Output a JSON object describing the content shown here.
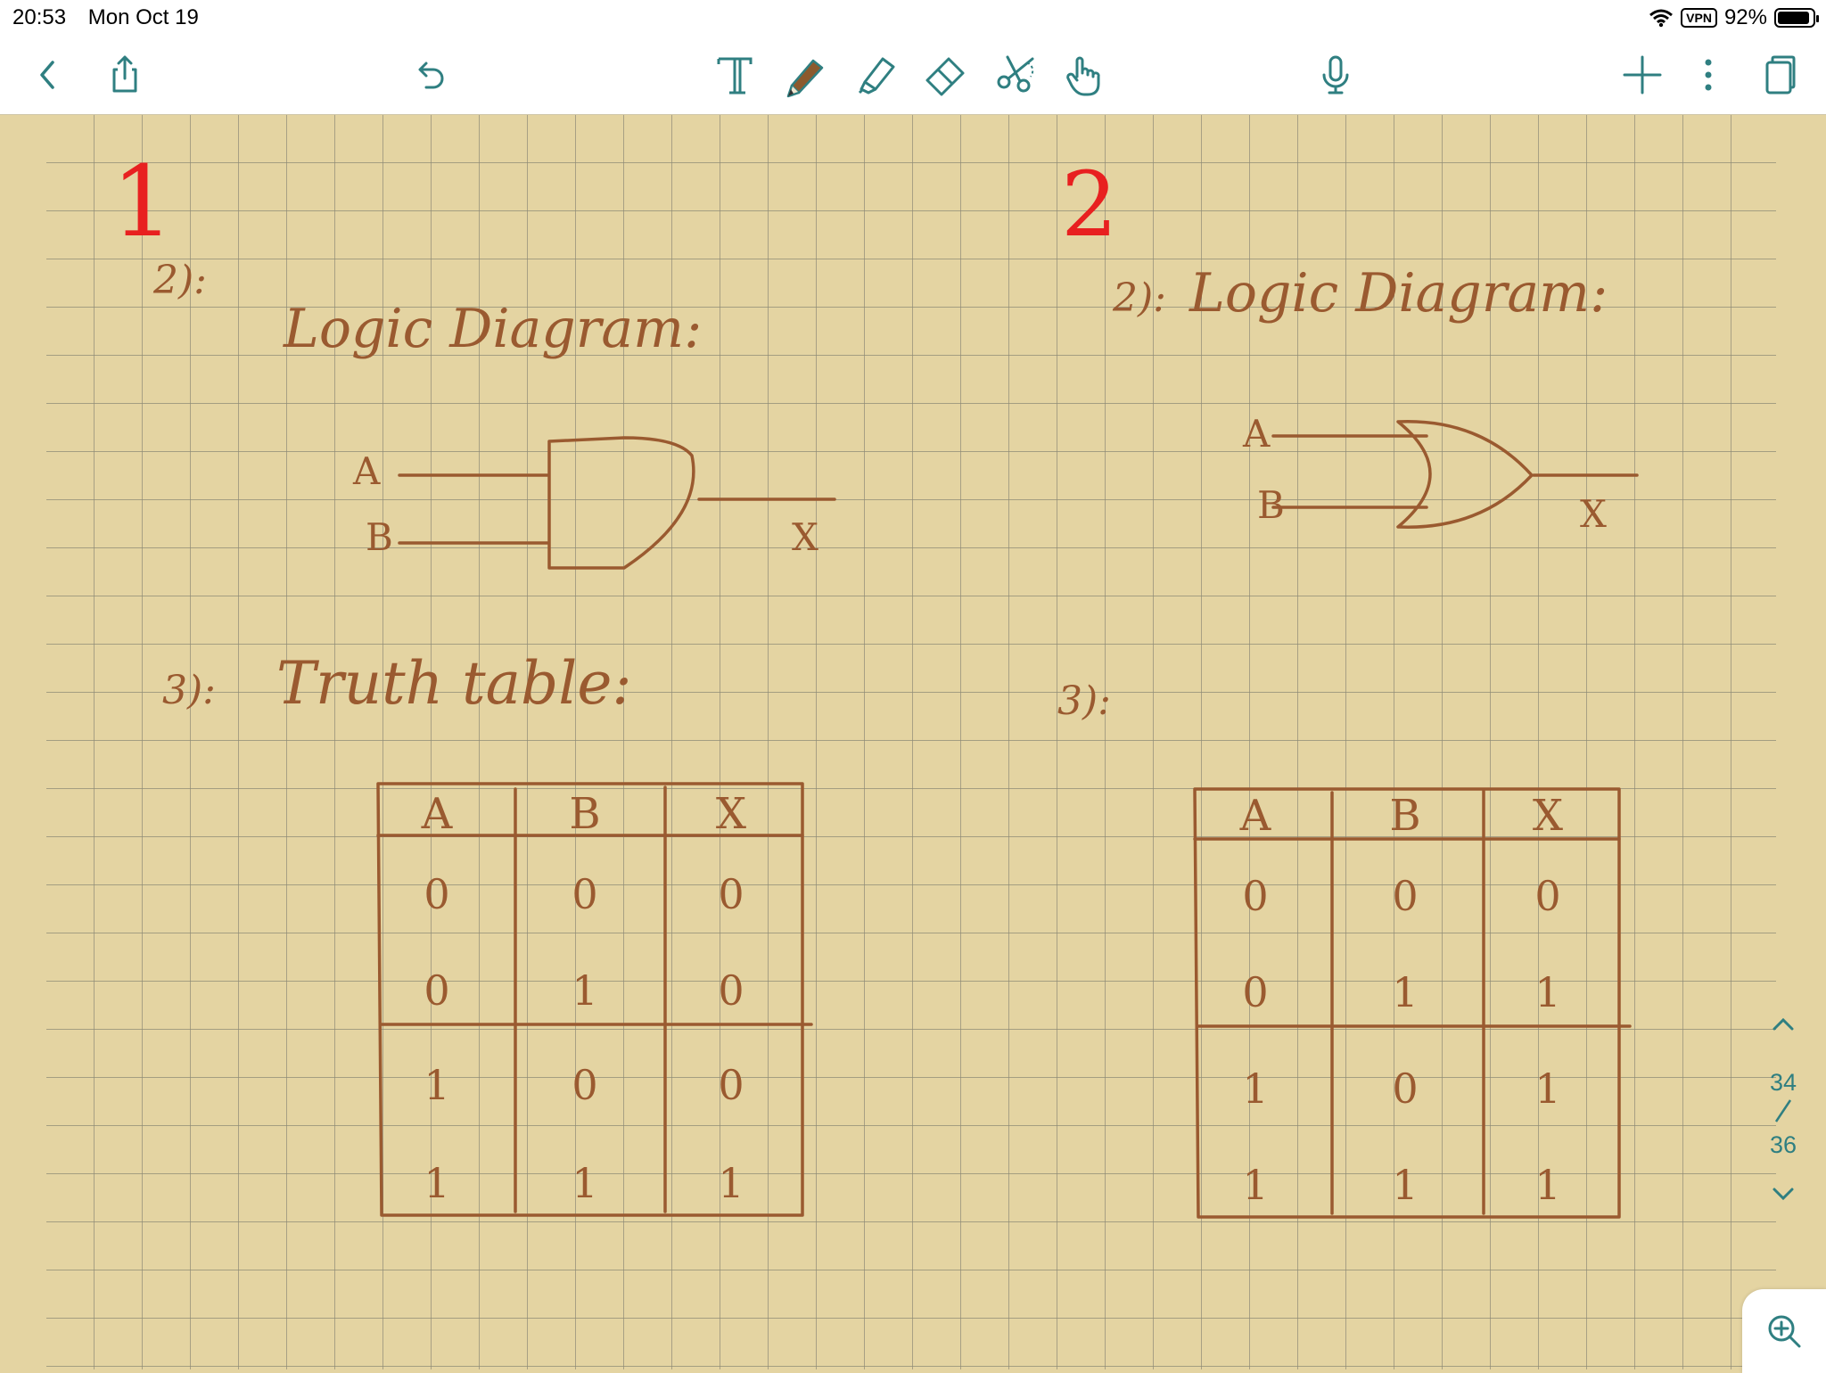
{
  "status": {
    "time": "20:53",
    "date": "Mon Oct 19",
    "vpn": "VPN",
    "battery": "92%",
    "battery_level": 0.92
  },
  "toolbar": {
    "tools": [
      "back-icon",
      "share-icon",
      "undo-icon",
      "text-tool-icon",
      "pen-tool-icon",
      "highlighter-icon",
      "eraser-icon",
      "lasso-scissors-icon",
      "hand-pointer-icon",
      "microphone-icon",
      "add-icon",
      "more-icon",
      "pages-icon"
    ]
  },
  "colors": {
    "ink": "#9a5a30",
    "red": "#e82020",
    "teal": "#2f7f81",
    "paper": "#e4d4a2",
    "grid": "#8e8b76"
  },
  "note": {
    "left": {
      "number": "1",
      "item2_label": "2):",
      "item2_title": "Logic Diagram:",
      "inputs": [
        "A",
        "B"
      ],
      "output": "X",
      "item3_label": "3):",
      "item3_title": "Truth table:",
      "table": {
        "headers": [
          "A",
          "B",
          "X"
        ],
        "rows": [
          [
            "0",
            "0",
            "0"
          ],
          [
            "0",
            "1",
            "0"
          ],
          [
            "1",
            "0",
            "0"
          ],
          [
            "1",
            "1",
            "1"
          ]
        ]
      }
    },
    "right": {
      "number": "2",
      "item2_label": "2):",
      "item2_title": "Logic Diagram:",
      "inputs": [
        "A",
        "B"
      ],
      "output": "X",
      "item3_label": "3):",
      "table": {
        "headers": [
          "A",
          "B",
          "X"
        ],
        "rows": [
          [
            "0",
            "0",
            "0"
          ],
          [
            "0",
            "1",
            "1"
          ],
          [
            "1",
            "0",
            "1"
          ],
          [
            "1",
            "1",
            "1"
          ]
        ]
      }
    }
  },
  "pager": {
    "current": "34",
    "total": "36"
  }
}
